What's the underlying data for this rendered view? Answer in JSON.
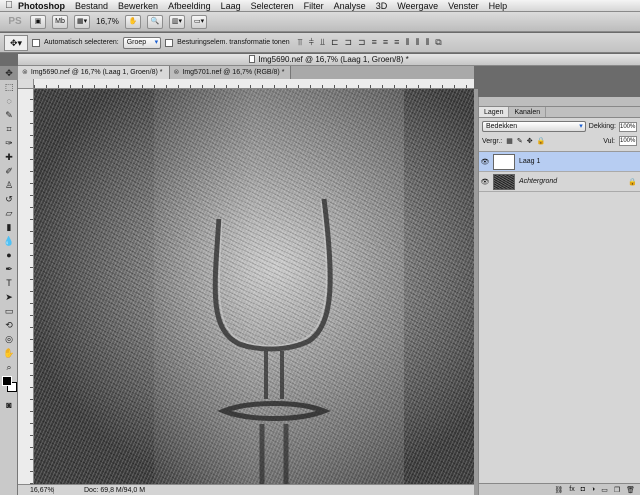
{
  "menubar": {
    "app_name": "Photoshop",
    "items": [
      "Bestand",
      "Bewerken",
      "Afbeelding",
      "Laag",
      "Selecteren",
      "Filter",
      "Analyse",
      "3D",
      "Weergave",
      "Venster",
      "Help"
    ]
  },
  "appbar": {
    "logo": "PS",
    "mb_label": "Mb",
    "zoom": "16,7%"
  },
  "options": {
    "auto_select_label": "Automatisch selecteren:",
    "auto_select_value": "Groep",
    "transform_label": "Besturingselem. transformatie tonen"
  },
  "window": {
    "title": "Img5690.nef @ 16,7% (Laag 1, Groen/8) *"
  },
  "tabs": [
    {
      "label": "Img5690.nef @ 16,7% (Laag 1, Groen/8) *"
    },
    {
      "label": "Img5701.nef @ 16,7% (RGB/8) *"
    }
  ],
  "layers_panel": {
    "tabs": [
      "Lagen",
      "Kanalen"
    ],
    "blend_mode": "Bedekken",
    "opacity_label": "Dekking:",
    "opacity_value": "100%",
    "lock_label": "Vergr.:",
    "fill_label": "Vul:",
    "fill_value": "100%",
    "layers": [
      {
        "name": "Laag 1",
        "selected": true
      },
      {
        "name": "Achtergrond",
        "selected": false
      }
    ]
  },
  "status": {
    "zoom": "16,67%",
    "doc": "Doc: 69,8 M/94,0 M"
  },
  "icons": [
    "apple-icon",
    "move-tool-icon",
    "eye-icon",
    "lock-icon",
    "link-icon",
    "fx-icon",
    "mask-icon",
    "new-layer-icon",
    "trash-icon"
  ]
}
